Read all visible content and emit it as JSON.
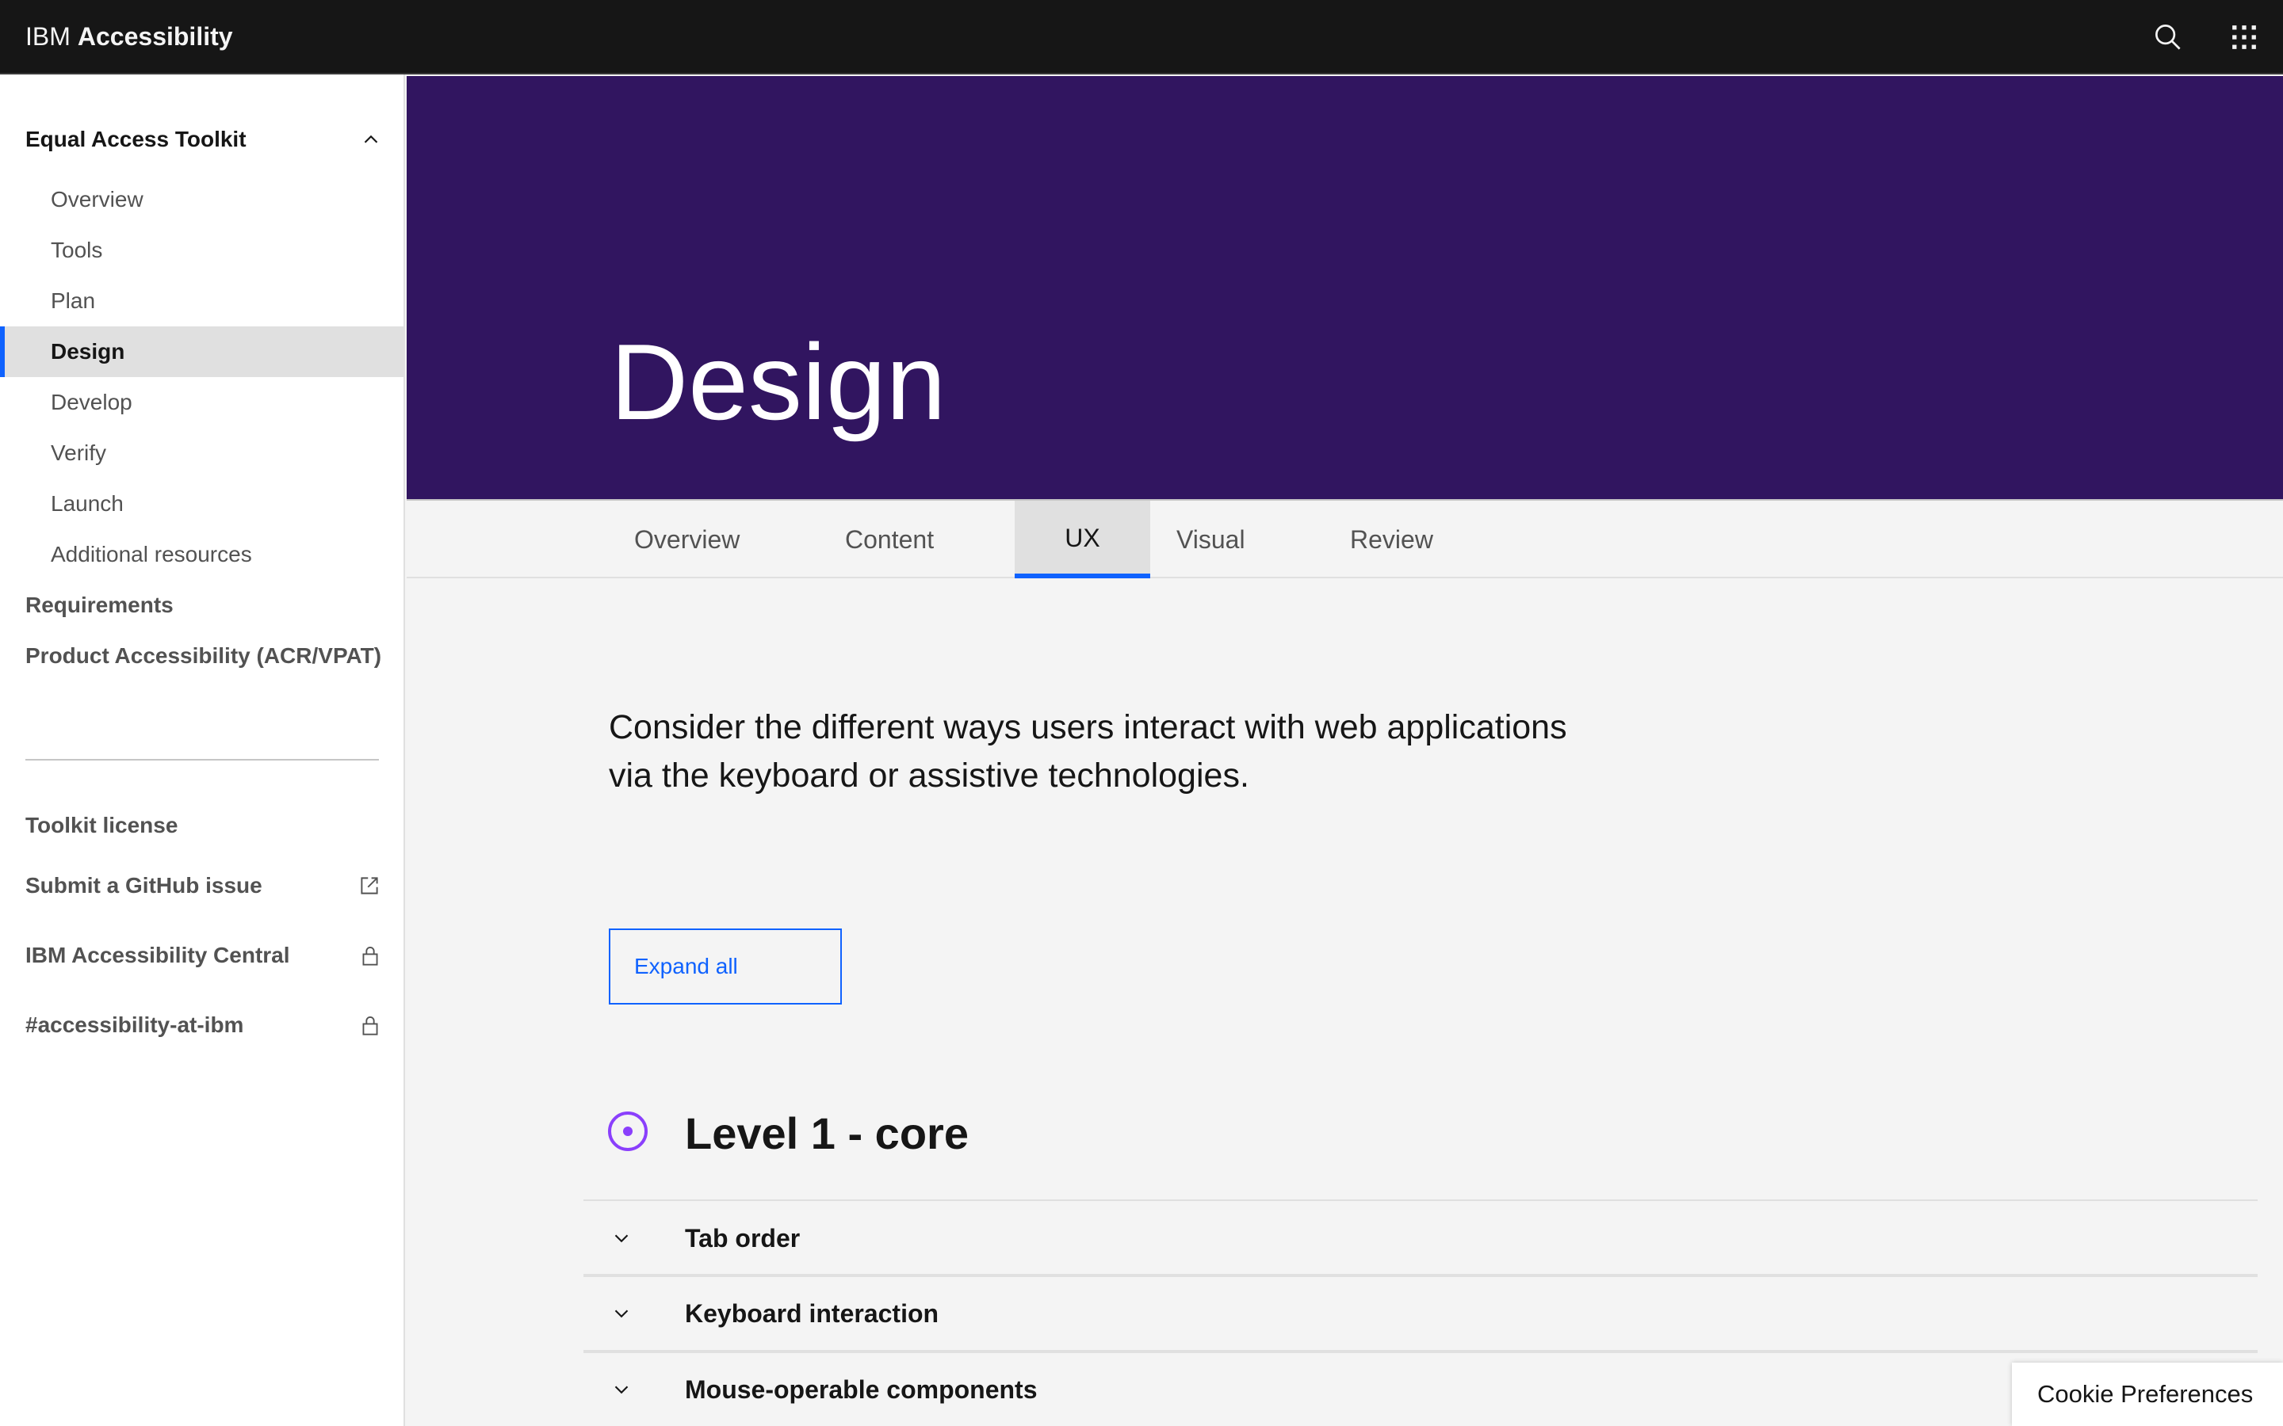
{
  "header": {
    "brand_prefix": "IBM",
    "brand_name": "Accessibility",
    "search_icon": "search-icon",
    "switcher_icon": "app-switcher-icon"
  },
  "sidebar": {
    "parent_label": "Equal Access Toolkit",
    "parent_expanded": true,
    "sub_items": [
      {
        "label": "Overview",
        "active": false
      },
      {
        "label": "Tools",
        "active": false
      },
      {
        "label": "Plan",
        "active": false
      },
      {
        "label": "Design",
        "active": true
      },
      {
        "label": "Develop",
        "active": false
      },
      {
        "label": "Verify",
        "active": false
      },
      {
        "label": "Launch",
        "active": false
      },
      {
        "label": "Additional resources",
        "active": false
      }
    ],
    "top_items": [
      {
        "label": "Requirements"
      },
      {
        "label": "Product Accessibility (ACR/VPAT)"
      }
    ],
    "footer_links": [
      {
        "label": "Toolkit license",
        "icon": ""
      },
      {
        "label": "Submit a GitHub issue",
        "icon": "external-link-icon"
      },
      {
        "label": "IBM Accessibility Central",
        "icon": "lock-icon"
      },
      {
        "label": "#accessibility-at-ibm",
        "icon": "lock-icon"
      }
    ]
  },
  "hero": {
    "title": "Design",
    "background": "#311560"
  },
  "tabs": [
    {
      "label": "Overview",
      "selected": false
    },
    {
      "label": "Content",
      "selected": false
    },
    {
      "label": "UX",
      "selected": true
    },
    {
      "label": "Visual",
      "selected": false
    },
    {
      "label": "Review",
      "selected": false
    }
  ],
  "main": {
    "lead_line1": "Consider the different ways users interact with web applications",
    "lead_line2": "via the keyboard or assistive technologies.",
    "expand_all_label": "Expand all",
    "level_title": "Level 1 - core",
    "level_icon": "level-1-icon",
    "accordion_items": [
      {
        "label": "Tab order"
      },
      {
        "label": "Keyboard interaction"
      },
      {
        "label": "Mouse-operable components"
      }
    ]
  },
  "cookie": {
    "label": "Cookie Preferences"
  },
  "colors": {
    "accent": "#0f62fe",
    "level_purple": "#8a3ffc",
    "header_bg": "#161616"
  }
}
